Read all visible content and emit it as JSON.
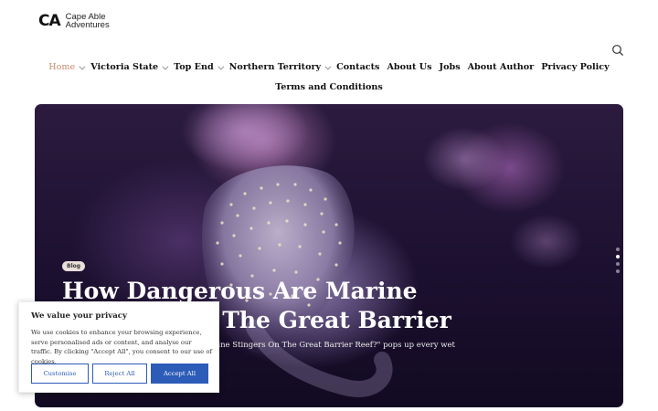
{
  "brand": {
    "mark": "CA",
    "name_line1": "Cape Able",
    "name_line2": "Adventures"
  },
  "search": {
    "icon": "search-icon"
  },
  "nav": {
    "row1": [
      {
        "label": "Home",
        "dropdown": true,
        "active": true
      },
      {
        "label": "Victoria State",
        "dropdown": true
      },
      {
        "label": "Top End",
        "dropdown": true
      },
      {
        "label": "Northern Territory",
        "dropdown": true
      },
      {
        "label": "Contacts"
      },
      {
        "label": "About Us"
      },
      {
        "label": "Jobs"
      },
      {
        "label": "About Author"
      },
      {
        "label": "Privacy Policy"
      }
    ],
    "row2": [
      {
        "label": "Terms and Conditions"
      }
    ]
  },
  "hero": {
    "badge": "Blog",
    "title": "How Dangerous Are Marine Stingers On The Great Barrier Reef?",
    "excerpt": "The question \"How Dangerous Are Marine Stingers On The Great Barrier Reef?\" pops up every wet season, usually right",
    "slides": 4,
    "active_slide": 2
  },
  "cookie": {
    "title": "We value your privacy",
    "body": "We use cookies to enhance your browsing experience, serve personalised ads or content, and analyse our traffic. By clicking \"Accept All\", you consent to our use of cookies.",
    "customise": "Customise",
    "reject": "Reject All",
    "accept": "Accept All"
  },
  "colors": {
    "accent": "#c98a6c",
    "button_blue": "#2c5bb8"
  }
}
